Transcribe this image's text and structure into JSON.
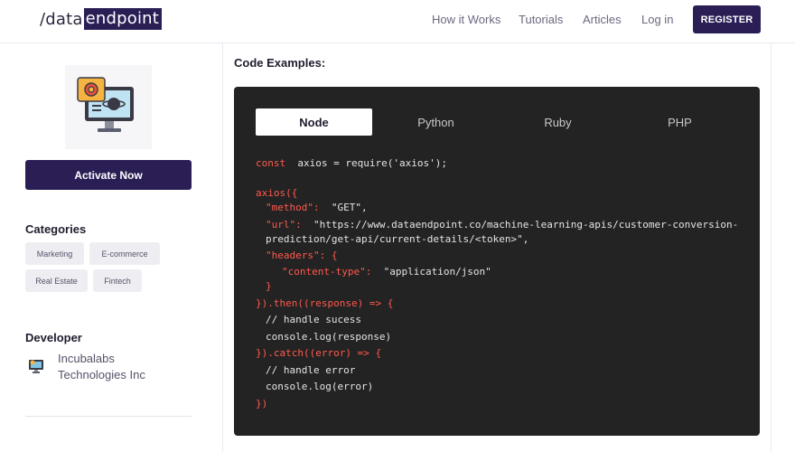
{
  "header": {
    "logo_prefix": "/data",
    "logo_highlight": "endpoint",
    "nav": [
      "How it Works",
      "Tutorials",
      "Articles",
      "Log in"
    ],
    "register_label": "REGISTER"
  },
  "sidebar": {
    "product_icon": "monitor-with-gear-icon",
    "activate_label": "Activate Now",
    "categories_title": "Categories",
    "categories": [
      "Marketing",
      "E-commerce",
      "Real Estate",
      "Fintech"
    ],
    "developer_title": "Developer",
    "developer_icon": "incubalabs-logo-icon",
    "developer_name": "Incubalabs Technologies Inc"
  },
  "main": {
    "code_title": "Code Examples:",
    "tabs": [
      "Node",
      "Python",
      "Ruby",
      "PHP"
    ],
    "active_tab": "Node",
    "code": {
      "l1_kw": "const",
      "l1_rest": "axios = require('axios');",
      "l2": "axios({",
      "l3_key": "\"method\":",
      "l3_val": "\"GET\",",
      "l4_key": "\"url\":",
      "l4_val": "\"https://www.dataendpoint.co/machine-learning-apis/customer-conversion-",
      "l5": "prediction/get-api/current-details/<token>\",",
      "l6": "\"headers\": {",
      "l7_key": "\"content-type\":",
      "l7_val": "\"application/json\"",
      "l8": "}",
      "l9": "}).then((response) => {",
      "l10": "// handle sucess",
      "l11": "console.log(response)",
      "l12": "}).catch((error) => {",
      "l13": "// handle error",
      "l14": "console.log(error)",
      "l15": "})"
    }
  },
  "colors": {
    "brand": "#2a1e55",
    "code_bg": "#232323",
    "code_keyword": "#ff5a4e",
    "tag_bg": "#eeeef2"
  }
}
